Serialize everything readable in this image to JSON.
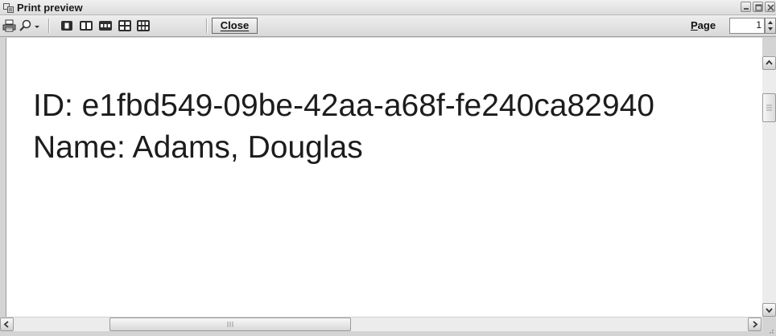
{
  "window": {
    "title": "Print preview",
    "controls": {
      "minimize_icon": "minimize-icon",
      "maximize_icon": "maximize-icon",
      "close_icon": "close-window-icon"
    }
  },
  "toolbar": {
    "icons": [
      "print-icon",
      "zoom-icon",
      "dropdown-arrow-icon",
      "one-page-icon",
      "two-pages-icon",
      "three-pages-icon",
      "four-pages-icon",
      "six-pages-icon"
    ],
    "close_label": "Close",
    "page_label": "Page",
    "page_value": "1"
  },
  "document": {
    "line1": "ID:  e1fbd549-09be-42aa-a68f-fe240ca82940",
    "line2": "Name: Adams, Douglas"
  },
  "colors": {
    "chrome": "#d4d4d4",
    "paper": "#ffffff",
    "text": "#1c1c1c"
  }
}
